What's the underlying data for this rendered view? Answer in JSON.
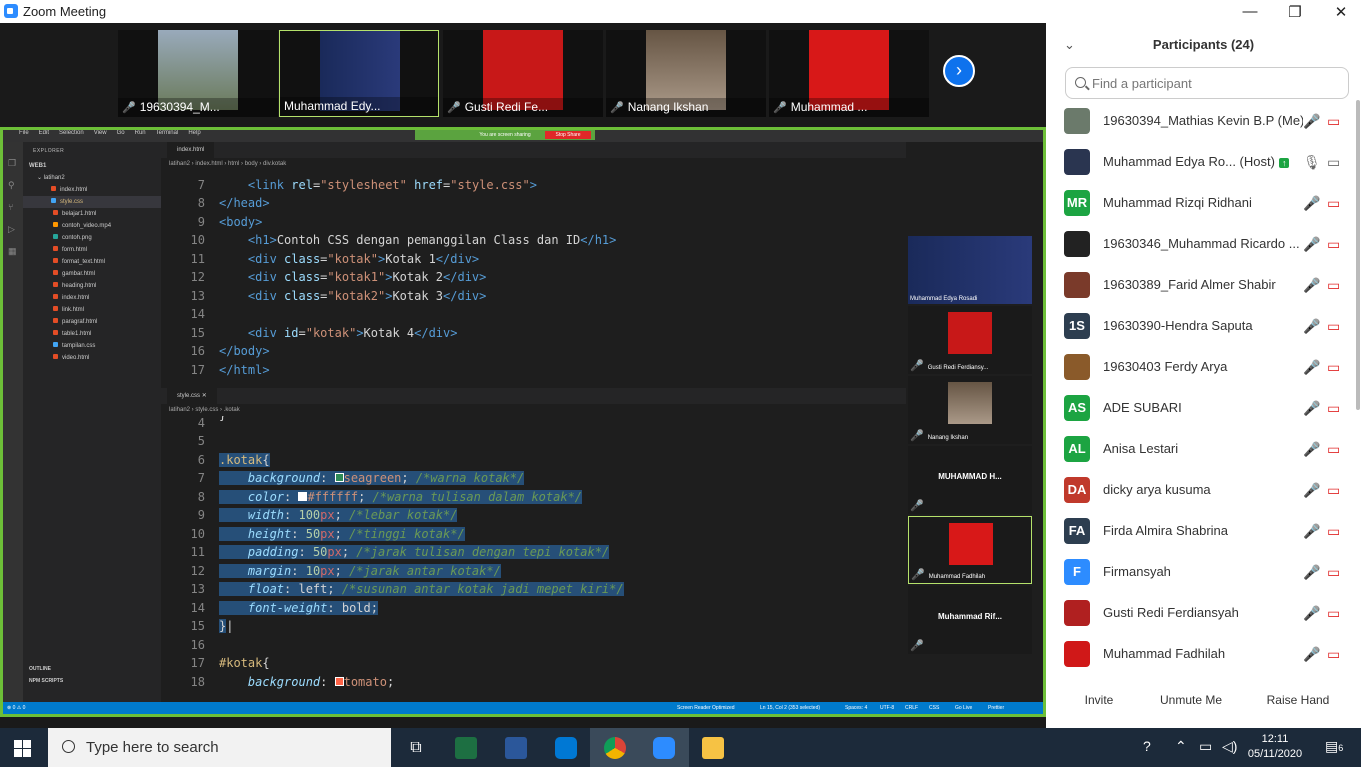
{
  "window": {
    "title": "Zoom Meeting",
    "controls": [
      "—",
      "❐",
      "✕"
    ]
  },
  "video_strip": {
    "tiles": [
      {
        "name": "19630394_M...",
        "muted": true
      },
      {
        "name": "Muhammad Edy...",
        "muted": false,
        "active": true
      },
      {
        "name": "Gusti Redi Fe...",
        "muted": true
      },
      {
        "name": "Nanang Ikshan",
        "muted": true
      },
      {
        "name": "Muhammad ...",
        "muted": true
      }
    ],
    "next_icon": "chevron-right-icon"
  },
  "shared_screen": {
    "menu": [
      "File",
      "Edit",
      "Selection",
      "View",
      "Go",
      "Run",
      "Terminal",
      "Help"
    ],
    "share_banner": "You are screen sharing",
    "stop_share": "Stop Share",
    "explorer": {
      "header": "EXPLORER",
      "root": "WEB1",
      "folder": "latihan2",
      "files": [
        "index.html",
        "style.css",
        "belajar1.html",
        "contoh_video.mp4",
        "contoh.png",
        "form.html",
        "format_text.html",
        "gambar.html",
        "heading.html",
        "index.html",
        "link.html",
        "paragraf.html",
        "table1.html",
        "tampilan.css",
        "video.html"
      ],
      "outline": "OUTLINE",
      "npm": "NPM SCRIPTS"
    },
    "editor_top": {
      "tab": "index.html",
      "breadcrumb": "latihan2 › index.html › html › body › div.kotak",
      "lines": [
        "7",
        "8",
        "9",
        "10",
        "11",
        "12",
        "13",
        "14",
        "15",
        "16",
        "17"
      ]
    },
    "editor_bottom": {
      "tab": "style.css",
      "close": "✕",
      "breadcrumb": "latihan2 › style.css › .kotak",
      "lines": [
        "4",
        "5",
        "6",
        "7",
        "8",
        "9",
        "10",
        "11",
        "12",
        "13",
        "14",
        "15",
        "16",
        "17",
        "18"
      ]
    },
    "status": {
      "left": "⊗ 0 ⚠ 0",
      "items": [
        "Screen Reader Optimized",
        "Ln 15, Col 2 (353 selected)",
        "Spaces: 4",
        "UTF-8",
        "CRLF",
        "CSS",
        "Go Live",
        "Prettier"
      ]
    },
    "thumbnails": [
      {
        "name": "Muhammad Edya Rosadi"
      },
      {
        "name": "Gusti Redi Ferdiansy..."
      },
      {
        "name": "Nanang Ikshan"
      },
      {
        "big": "MUHAMMAD H..."
      },
      {
        "name": "Muhammad Fadhilah"
      },
      {
        "big": "Muhammad Rif..."
      }
    ]
  },
  "participants": {
    "title": "Participants (24)",
    "search_placeholder": "Find a participant",
    "list": [
      {
        "name": "19630394_Mathias Kevin B.P (Me)",
        "avatar": "",
        "color": "#6b7a6b"
      },
      {
        "name": "Muhammad Edya Ro... (Host)",
        "avatar": "",
        "color": "#2a3550",
        "host": true
      },
      {
        "name": "Muhammad Rizqi Ridhani",
        "avatar": "MR",
        "color": "#1ca442"
      },
      {
        "name": "19630346_Muhammad Ricardo ...",
        "avatar": "",
        "color": "#222"
      },
      {
        "name": "19630389_Farid Almer Shabir",
        "avatar": "",
        "color": "#7a3a2a"
      },
      {
        "name": "19630390-Hendra Saputa",
        "avatar": "1S",
        "color": "#2d3e50"
      },
      {
        "name": "19630403 Ferdy Arya",
        "avatar": "",
        "color": "#8a5a2a"
      },
      {
        "name": "ADE SUBARI",
        "avatar": "AS",
        "color": "#1ca442"
      },
      {
        "name": "Anisa Lestari",
        "avatar": "AL",
        "color": "#1ca442"
      },
      {
        "name": "dicky arya kusuma",
        "avatar": "DA",
        "color": "#c0392b"
      },
      {
        "name": "Firda Almira Shabrina",
        "avatar": "FA",
        "color": "#2d3e50"
      },
      {
        "name": "Firmansyah",
        "avatar": "F",
        "color": "#2d8cff"
      },
      {
        "name": "Gusti Redi Ferdiansyah",
        "avatar": "",
        "color": "#b02020"
      },
      {
        "name": "Muhammad Fadhilah",
        "avatar": "",
        "color": "#d01818"
      }
    ],
    "buttons": [
      "Invite",
      "Unmute Me",
      "Raise Hand"
    ]
  },
  "taskbar": {
    "search_placeholder": "Type here to search",
    "time": "12:11",
    "date": "05/11/2020",
    "notifications": "6"
  }
}
